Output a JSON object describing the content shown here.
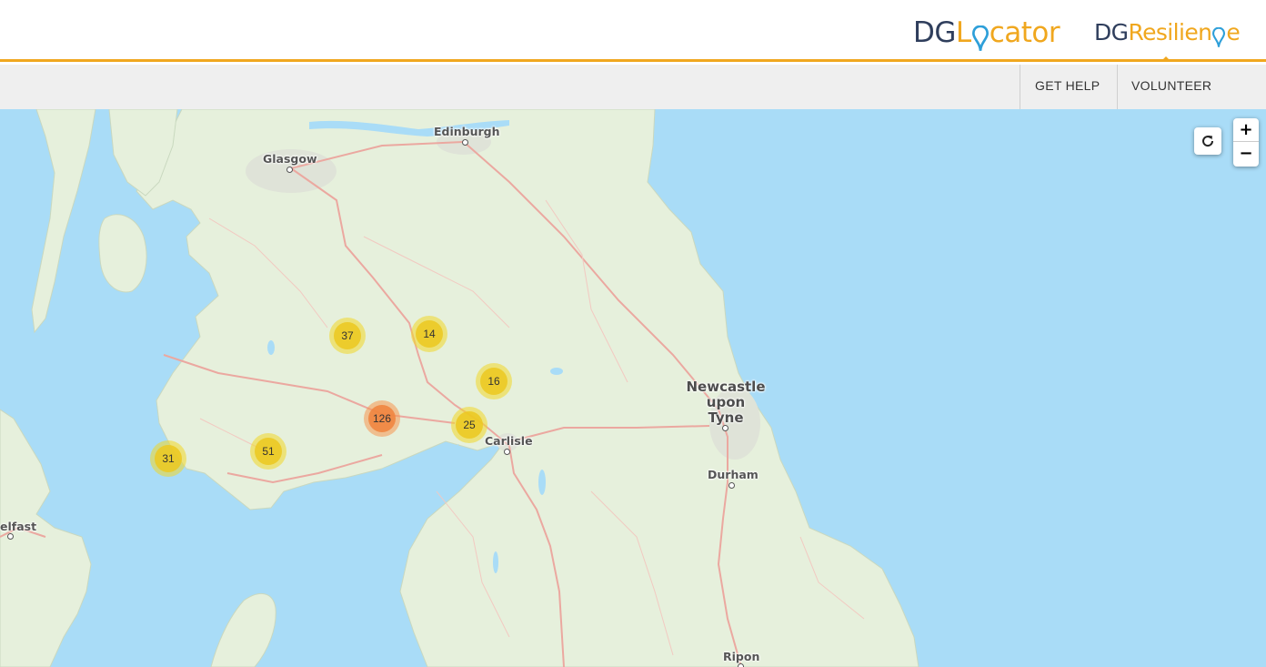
{
  "header": {
    "logo_locator": {
      "prefix": "DG",
      "word_start": "L",
      "word_end": "cator",
      "pin_icon": "map-pin-icon"
    },
    "logo_resilience": {
      "prefix": "DG",
      "word_start": "Resilien",
      "word_end": "e",
      "pin_icon": "map-pin-icon"
    },
    "colors": {
      "brand_dark": "#2f3e5c",
      "brand_orange": "#f0a71e",
      "pin_blue": "#2d9fd9"
    }
  },
  "nav": {
    "items": [
      {
        "label": "GET HELP"
      },
      {
        "label": "VOLUNTEER"
      }
    ]
  },
  "map": {
    "places": {
      "edinburgh": "Edinburgh",
      "glasgow": "Glasgow",
      "newcastle_1": "Newcastle",
      "newcastle_2": "upon",
      "newcastle_3": "Tyne",
      "carlisle": "Carlisle",
      "durham": "Durham",
      "belfast": "elfast",
      "ripon": "Ripon"
    },
    "clusters": [
      {
        "count": "37",
        "level": "mid"
      },
      {
        "count": "14",
        "level": "mid"
      },
      {
        "count": "16",
        "level": "mid"
      },
      {
        "count": "126",
        "level": "big"
      },
      {
        "count": "25",
        "level": "mid"
      },
      {
        "count": "51",
        "level": "mid"
      },
      {
        "count": "31",
        "level": "mid"
      }
    ],
    "controls": {
      "refresh_icon": "refresh-icon",
      "zoom_in": "+",
      "zoom_out": "−"
    },
    "colors": {
      "sea": "#a9dcf7",
      "land": "#e6f0dc",
      "road": "#eba8a0"
    }
  }
}
